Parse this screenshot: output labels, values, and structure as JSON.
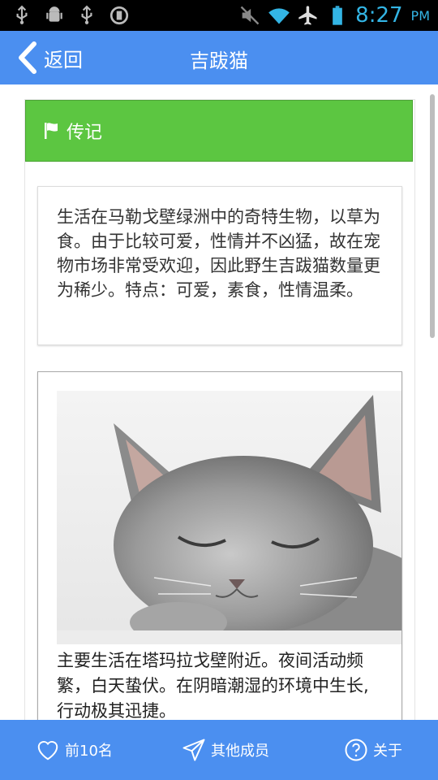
{
  "status_bar": {
    "time": "8:27",
    "ampm": "PM",
    "icons": [
      "usb-icon",
      "android-debug-icon",
      "usb-icon",
      "sync-icon",
      "mute-icon",
      "wifi-icon",
      "airplane-mode-icon",
      "battery-icon"
    ],
    "color": "#33b5e5"
  },
  "header": {
    "back_label": "返回",
    "title": "吉跋猫",
    "color": "#4b8ff0"
  },
  "section": {
    "title": "传记",
    "icon": "flag-icon",
    "color": "#5cc641"
  },
  "description": "生活在马勒戈壁绿洲中的奇特生物，以草为食。由于比较可爱，性情并不凶猛，故在宠物市场非常受欢迎，因此野生吉跋猫数量更为稀少。特点：可爱，素食，性情温柔。",
  "photo": {
    "subject": "sleeping-gray-kitten",
    "caption": "主要生活在塔玛拉戈壁附近。夜间活动频繁，白天蛰伏。在阴暗潮湿的环境中生长,行动极其迅捷。"
  },
  "bottom_nav": {
    "items": [
      {
        "label": "前10名",
        "icon": "heart-icon"
      },
      {
        "label": "其他成员",
        "icon": "paper-plane-icon"
      },
      {
        "label": "关于",
        "icon": "help-circle-icon"
      }
    ],
    "color": "#4b8ff0"
  }
}
